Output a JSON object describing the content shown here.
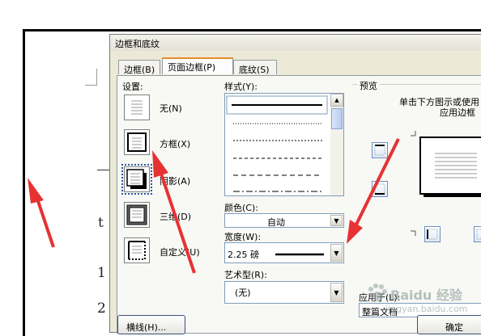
{
  "dialog": {
    "title": "边框和底纹",
    "tabs": [
      {
        "label": "边框(B)",
        "active": false
      },
      {
        "label": "页面边框(P)",
        "active": true
      },
      {
        "label": "底纹(S)",
        "active": false
      }
    ]
  },
  "settings": {
    "label": "设置:",
    "items": [
      {
        "label": "无(N)"
      },
      {
        "label": "方框(X)"
      },
      {
        "label": "阴影(A)",
        "selected": true
      },
      {
        "label": "三维(D)"
      },
      {
        "label": "自定义(U)"
      }
    ]
  },
  "style": {
    "label": "样式(Y):"
  },
  "color": {
    "label": "颜色(C):",
    "value": "自动"
  },
  "width": {
    "label": "宽度(W):",
    "value": "2.25 磅"
  },
  "art": {
    "label": "艺术型(R):",
    "value": "(无)"
  },
  "preview": {
    "label": "预览",
    "hint_line1": "单击下方图示或使用",
    "hint_line2": "应用边框"
  },
  "apply_to": {
    "label": "应用于(L):",
    "value": "整篇文档"
  },
  "buttons": {
    "horizontal_line": "横线(H)...",
    "ok": "确定"
  },
  "watermark": {
    "text": "Baidu 经验",
    "url": "jingyan.baidu.com"
  },
  "document": {
    "chars": [
      "t",
      "1",
      "2"
    ]
  },
  "colors": {
    "annotation_arrow": "#e63232",
    "accent_tab": "#e68b2c"
  }
}
